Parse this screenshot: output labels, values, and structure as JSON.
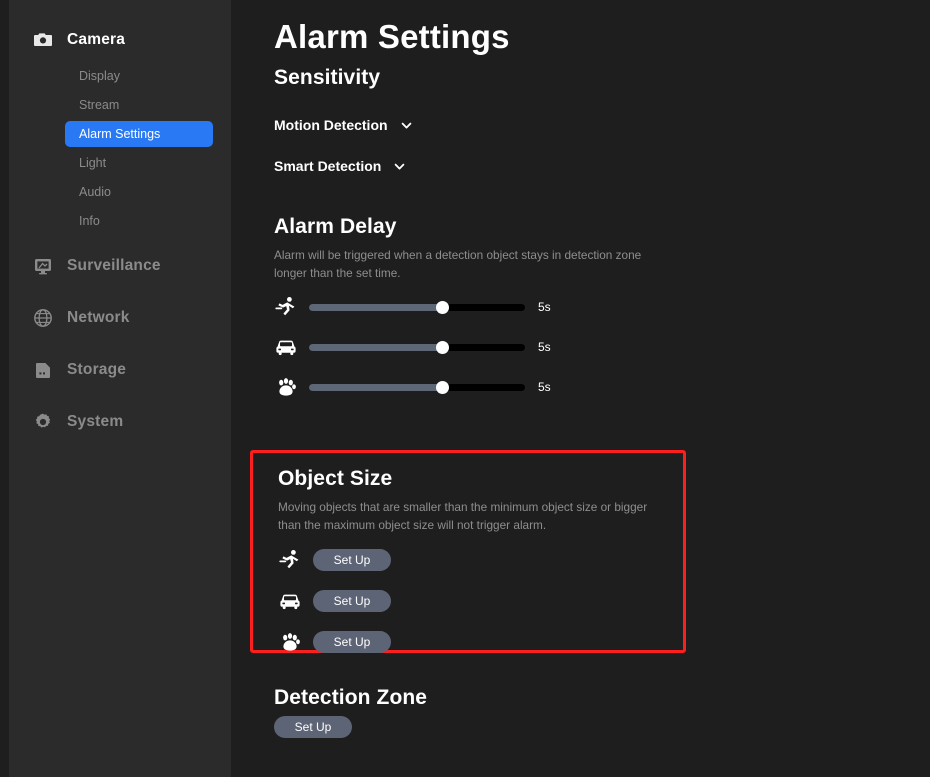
{
  "sidebar": {
    "groups": [
      {
        "label": "Camera",
        "icon": "camera-icon",
        "active": true,
        "items": [
          {
            "label": "Display",
            "selected": false
          },
          {
            "label": "Stream",
            "selected": false
          },
          {
            "label": "Alarm Settings",
            "selected": true
          },
          {
            "label": "Light",
            "selected": false
          },
          {
            "label": "Audio",
            "selected": false
          },
          {
            "label": "Info",
            "selected": false
          }
        ]
      },
      {
        "label": "Surveillance",
        "icon": "monitor-icon",
        "active": false,
        "items": []
      },
      {
        "label": "Network",
        "icon": "globe-icon",
        "active": false,
        "items": []
      },
      {
        "label": "Storage",
        "icon": "sdcard-icon",
        "active": false,
        "items": []
      },
      {
        "label": "System",
        "icon": "gear-icon",
        "active": false,
        "items": []
      }
    ]
  },
  "main": {
    "page_title": "Alarm Settings",
    "sensitivity": {
      "title": "Sensitivity",
      "rows": [
        {
          "label": "Motion Detection",
          "icon": "chevron-down-icon"
        },
        {
          "label": "Smart Detection",
          "icon": "chevron-down-icon"
        }
      ]
    },
    "alarm_delay": {
      "title": "Alarm Delay",
      "description": "Alarm will be triggered when a detection object stays in detection zone longer than the set time.",
      "sliders": [
        {
          "icon": "person-running-icon",
          "value": "5s",
          "percent": 62
        },
        {
          "icon": "car-icon",
          "value": "5s",
          "percent": 62
        },
        {
          "icon": "paw-icon",
          "value": "5s",
          "percent": 62
        }
      ]
    },
    "object_size": {
      "title": "Object Size",
      "description": "Moving objects that are smaller than the minimum object size or bigger than the maximum object size will not trigger alarm.",
      "highlight_color": "#fc1f1f",
      "rows": [
        {
          "icon": "person-running-icon",
          "button": "Set Up"
        },
        {
          "icon": "car-icon",
          "button": "Set Up"
        },
        {
          "icon": "paw-icon",
          "button": "Set Up"
        }
      ]
    },
    "detection_zone": {
      "title": "Detection Zone",
      "button": "Set Up"
    }
  },
  "colors": {
    "accent": "#2979f5",
    "highlight": "#fc1f1f",
    "button": "#5d6475",
    "slider_fill": "#5d6775",
    "sidebar_bg": "#2b2b2b",
    "main_bg": "#1e1e1e"
  }
}
